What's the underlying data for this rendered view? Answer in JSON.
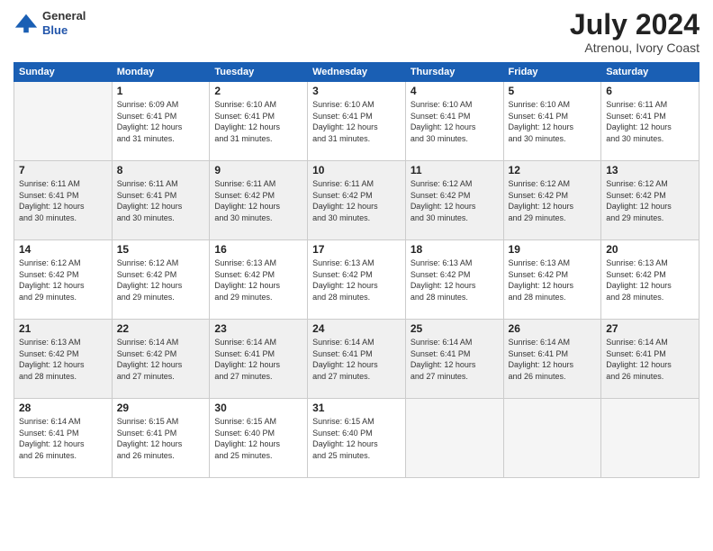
{
  "header": {
    "logo_line1": "General",
    "logo_line2": "Blue",
    "month": "July 2024",
    "location": "Atrenou, Ivory Coast"
  },
  "days_of_week": [
    "Sunday",
    "Monday",
    "Tuesday",
    "Wednesday",
    "Thursday",
    "Friday",
    "Saturday"
  ],
  "weeks": [
    [
      {
        "day": "",
        "info": ""
      },
      {
        "day": "1",
        "info": "Sunrise: 6:09 AM\nSunset: 6:41 PM\nDaylight: 12 hours\nand 31 minutes."
      },
      {
        "day": "2",
        "info": "Sunrise: 6:10 AM\nSunset: 6:41 PM\nDaylight: 12 hours\nand 31 minutes."
      },
      {
        "day": "3",
        "info": "Sunrise: 6:10 AM\nSunset: 6:41 PM\nDaylight: 12 hours\nand 31 minutes."
      },
      {
        "day": "4",
        "info": "Sunrise: 6:10 AM\nSunset: 6:41 PM\nDaylight: 12 hours\nand 30 minutes."
      },
      {
        "day": "5",
        "info": "Sunrise: 6:10 AM\nSunset: 6:41 PM\nDaylight: 12 hours\nand 30 minutes."
      },
      {
        "day": "6",
        "info": "Sunrise: 6:11 AM\nSunset: 6:41 PM\nDaylight: 12 hours\nand 30 minutes."
      }
    ],
    [
      {
        "day": "7",
        "info": "Sunrise: 6:11 AM\nSunset: 6:41 PM\nDaylight: 12 hours\nand 30 minutes."
      },
      {
        "day": "8",
        "info": "Sunrise: 6:11 AM\nSunset: 6:41 PM\nDaylight: 12 hours\nand 30 minutes."
      },
      {
        "day": "9",
        "info": "Sunrise: 6:11 AM\nSunset: 6:42 PM\nDaylight: 12 hours\nand 30 minutes."
      },
      {
        "day": "10",
        "info": "Sunrise: 6:11 AM\nSunset: 6:42 PM\nDaylight: 12 hours\nand 30 minutes."
      },
      {
        "day": "11",
        "info": "Sunrise: 6:12 AM\nSunset: 6:42 PM\nDaylight: 12 hours\nand 30 minutes."
      },
      {
        "day": "12",
        "info": "Sunrise: 6:12 AM\nSunset: 6:42 PM\nDaylight: 12 hours\nand 29 minutes."
      },
      {
        "day": "13",
        "info": "Sunrise: 6:12 AM\nSunset: 6:42 PM\nDaylight: 12 hours\nand 29 minutes."
      }
    ],
    [
      {
        "day": "14",
        "info": "Sunrise: 6:12 AM\nSunset: 6:42 PM\nDaylight: 12 hours\nand 29 minutes."
      },
      {
        "day": "15",
        "info": "Sunrise: 6:12 AM\nSunset: 6:42 PM\nDaylight: 12 hours\nand 29 minutes."
      },
      {
        "day": "16",
        "info": "Sunrise: 6:13 AM\nSunset: 6:42 PM\nDaylight: 12 hours\nand 29 minutes."
      },
      {
        "day": "17",
        "info": "Sunrise: 6:13 AM\nSunset: 6:42 PM\nDaylight: 12 hours\nand 28 minutes."
      },
      {
        "day": "18",
        "info": "Sunrise: 6:13 AM\nSunset: 6:42 PM\nDaylight: 12 hours\nand 28 minutes."
      },
      {
        "day": "19",
        "info": "Sunrise: 6:13 AM\nSunset: 6:42 PM\nDaylight: 12 hours\nand 28 minutes."
      },
      {
        "day": "20",
        "info": "Sunrise: 6:13 AM\nSunset: 6:42 PM\nDaylight: 12 hours\nand 28 minutes."
      }
    ],
    [
      {
        "day": "21",
        "info": "Sunrise: 6:13 AM\nSunset: 6:42 PM\nDaylight: 12 hours\nand 28 minutes."
      },
      {
        "day": "22",
        "info": "Sunrise: 6:14 AM\nSunset: 6:42 PM\nDaylight: 12 hours\nand 27 minutes."
      },
      {
        "day": "23",
        "info": "Sunrise: 6:14 AM\nSunset: 6:41 PM\nDaylight: 12 hours\nand 27 minutes."
      },
      {
        "day": "24",
        "info": "Sunrise: 6:14 AM\nSunset: 6:41 PM\nDaylight: 12 hours\nand 27 minutes."
      },
      {
        "day": "25",
        "info": "Sunrise: 6:14 AM\nSunset: 6:41 PM\nDaylight: 12 hours\nand 27 minutes."
      },
      {
        "day": "26",
        "info": "Sunrise: 6:14 AM\nSunset: 6:41 PM\nDaylight: 12 hours\nand 26 minutes."
      },
      {
        "day": "27",
        "info": "Sunrise: 6:14 AM\nSunset: 6:41 PM\nDaylight: 12 hours\nand 26 minutes."
      }
    ],
    [
      {
        "day": "28",
        "info": "Sunrise: 6:14 AM\nSunset: 6:41 PM\nDaylight: 12 hours\nand 26 minutes."
      },
      {
        "day": "29",
        "info": "Sunrise: 6:15 AM\nSunset: 6:41 PM\nDaylight: 12 hours\nand 26 minutes."
      },
      {
        "day": "30",
        "info": "Sunrise: 6:15 AM\nSunset: 6:40 PM\nDaylight: 12 hours\nand 25 minutes."
      },
      {
        "day": "31",
        "info": "Sunrise: 6:15 AM\nSunset: 6:40 PM\nDaylight: 12 hours\nand 25 minutes."
      },
      {
        "day": "",
        "info": ""
      },
      {
        "day": "",
        "info": ""
      },
      {
        "day": "",
        "info": ""
      }
    ]
  ]
}
